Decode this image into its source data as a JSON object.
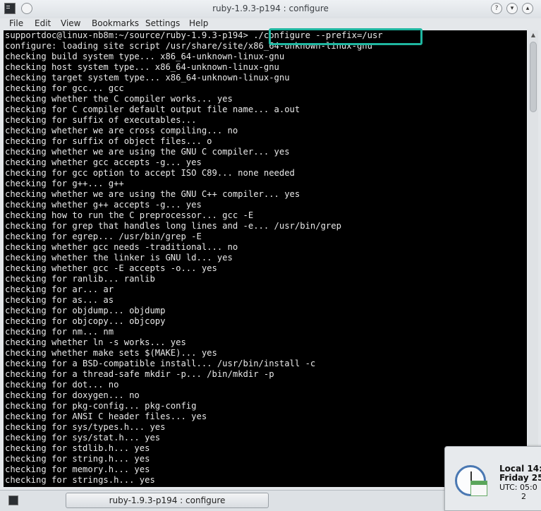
{
  "window": {
    "title": "ruby-1.9.3-p194 : configure"
  },
  "menu": {
    "items": [
      "File",
      "Edit",
      "View",
      "Bookmarks",
      "Settings",
      "Help"
    ]
  },
  "terminal": {
    "prompt": "supportdoc@linux-nb8m:~/source/ruby-1.9.3-p194>",
    "command": " ./configure --prefix=/usr",
    "lines": [
      "configure: loading site script /usr/share/site/x86_64-unknown-linux-gnu",
      "checking build system type... x86_64-unknown-linux-gnu",
      "checking host system type... x86_64-unknown-linux-gnu",
      "checking target system type... x86_64-unknown-linux-gnu",
      "checking for gcc... gcc",
      "checking whether the C compiler works... yes",
      "checking for C compiler default output file name... a.out",
      "checking for suffix of executables...",
      "checking whether we are cross compiling... no",
      "checking for suffix of object files... o",
      "checking whether we are using the GNU C compiler... yes",
      "checking whether gcc accepts -g... yes",
      "checking for gcc option to accept ISO C89... none needed",
      "checking for g++... g++",
      "checking whether we are using the GNU C++ compiler... yes",
      "checking whether g++ accepts -g... yes",
      "checking how to run the C preprocessor... gcc -E",
      "checking for grep that handles long lines and -e... /usr/bin/grep",
      "checking for egrep... /usr/bin/grep -E",
      "checking whether gcc needs -traditional... no",
      "checking whether the linker is GNU ld... yes",
      "checking whether gcc -E accepts -o... yes",
      "checking for ranlib... ranlib",
      "checking for ar... ar",
      "checking for as... as",
      "checking for objdump... objdump",
      "checking for objcopy... objcopy",
      "checking for nm... nm",
      "checking whether ln -s works... yes",
      "checking whether make sets $(MAKE)... yes",
      "checking for a BSD-compatible install... /usr/bin/install -c",
      "checking for a thread-safe mkdir -p... /bin/mkdir -p",
      "checking for dot... no",
      "checking for doxygen... no",
      "checking for pkg-config... pkg-config",
      "checking for ANSI C header files... yes",
      "checking for sys/types.h... yes",
      "checking for sys/stat.h... yes",
      "checking for stdlib.h... yes",
      "checking for string.h... yes",
      "checking for memory.h... yes",
      "checking for strings.h... yes"
    ]
  },
  "taskbar": {
    "task_label": "ruby-1.9.3-p194 : configure"
  },
  "clock": {
    "local": "Local 14:",
    "day": "Friday 25",
    "utc": "UTC: 05:0",
    "extra": "2"
  },
  "colors": {
    "terminal_bg": "#000000",
    "terminal_fg": "#e9e9e9",
    "highlight": "#1fb6a0"
  }
}
